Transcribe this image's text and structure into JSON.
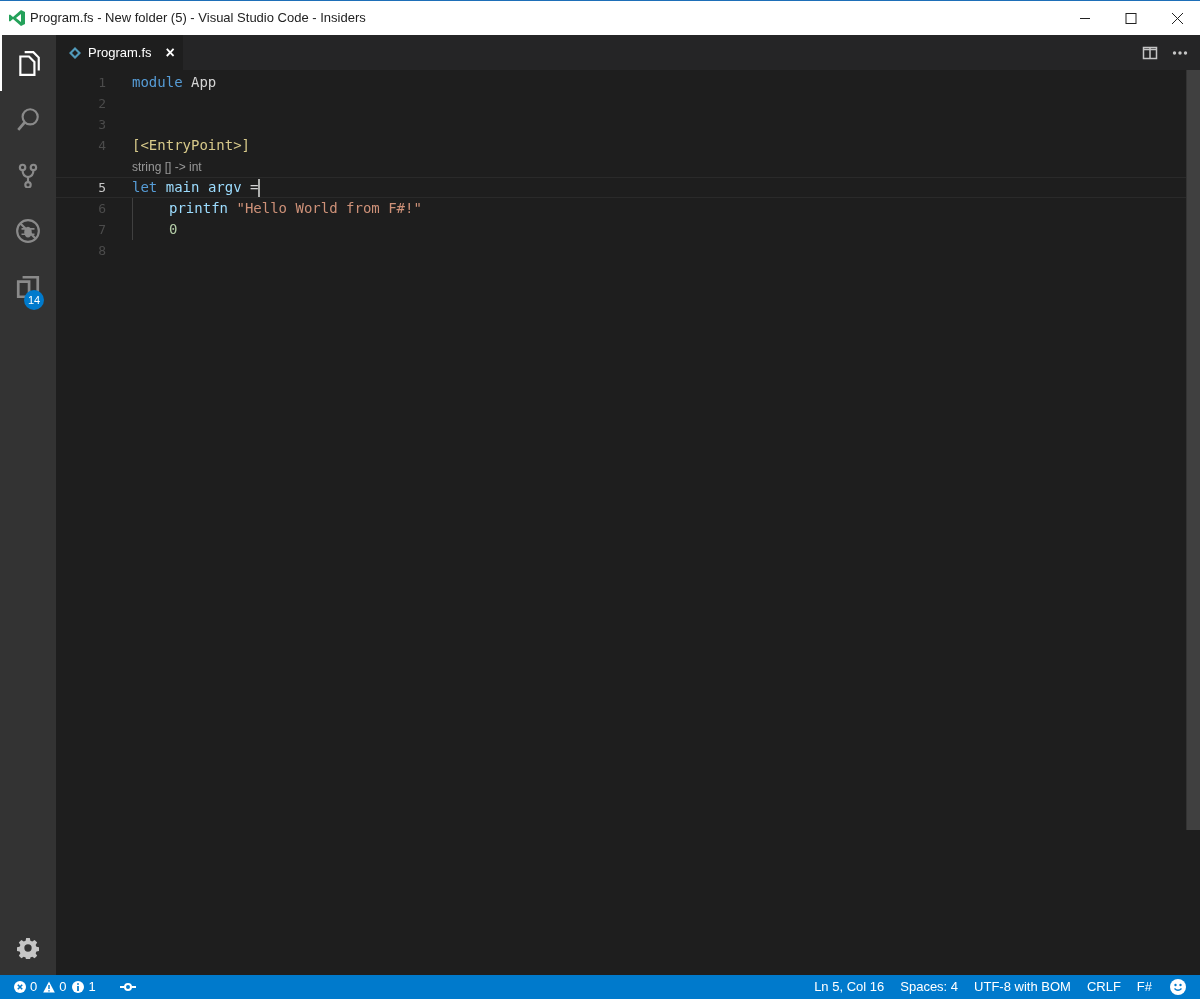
{
  "window": {
    "title": "Program.fs - New folder (5) - Visual Studio Code - Insiders"
  },
  "activity_bar": {
    "items": [
      {
        "kind": "files",
        "selected": true
      },
      {
        "kind": "search",
        "selected": false
      },
      {
        "kind": "scm",
        "selected": false
      },
      {
        "kind": "debug",
        "selected": false
      },
      {
        "kind": "extensions",
        "selected": false,
        "badge": "14"
      }
    ]
  },
  "tabs": [
    {
      "label": "Program.fs",
      "selected": true,
      "close": "×"
    }
  ],
  "editor": {
    "lines": [
      {
        "number": "1",
        "current": false,
        "indented": false,
        "tokens": [
          {
            "kind": "keyword",
            "text": "module"
          },
          {
            "kind": "plain",
            "text": "App"
          }
        ]
      },
      {
        "number": "2",
        "current": false,
        "indented": false
      },
      {
        "number": "3",
        "current": false,
        "indented": false
      },
      {
        "number": "4",
        "current": false,
        "indented": false,
        "tokens": [
          {
            "kind": "attribute",
            "text": "[<EntryPoint>]"
          }
        ]
      },
      {
        "number": "5",
        "current": true,
        "indented": false,
        "codelens": "string [] -> int",
        "tokens": [
          {
            "kind": "keyword",
            "text": "let"
          },
          {
            "kind": "ident",
            "text": "main"
          },
          {
            "kind": "ident",
            "text": "argv"
          },
          {
            "kind": "plain",
            "text": "="
          }
        ]
      },
      {
        "number": "6",
        "current": false,
        "indented": true,
        "tokens": [
          {
            "kind": "ident",
            "text": "printfn"
          },
          {
            "kind": "string",
            "text": "\"Hello World from F#!\""
          }
        ]
      },
      {
        "number": "7",
        "current": false,
        "indented": true,
        "tokens": [
          {
            "kind": "number",
            "text": "0"
          }
        ]
      },
      {
        "number": "8",
        "current": false,
        "indented": false
      }
    ]
  },
  "status_bar": {
    "errors": "0",
    "warnings": "0",
    "infos": "1",
    "right": [
      "Ln 5, Col 16",
      "Spaces: 4",
      "UTF-8 with BOM",
      "CRLF",
      "F#"
    ]
  }
}
